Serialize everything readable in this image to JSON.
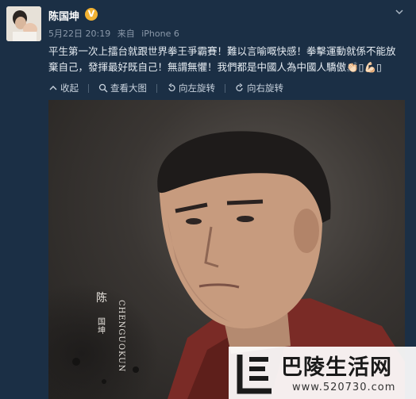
{
  "post": {
    "author": "陈国坤",
    "verified_badge": "V",
    "date": "5月22日 20:19",
    "via_label": "来自",
    "device": "iPhone 6",
    "text_line1": "平生第一次上擂台就跟世界拳王爭霸賽！難以言喻嘅快感！拳擊運動就係不能放",
    "text_line2": "棄自己，發揮最好既自己！無謂無懼！我們都是中國人為中國人驕傲👏🏻▯💪🏻▯"
  },
  "toolbar": {
    "collapse_label": "收起",
    "view_large_label": "查看大图",
    "rotate_left_label": "向左旋转",
    "rotate_right_label": "向右旋转"
  },
  "image": {
    "name_vertical": "陈",
    "name_small": "国坤",
    "name_english": "CHENGUOKUN"
  },
  "watermark": {
    "title": "巴陵生活网",
    "url": "www.520730.com"
  },
  "colors": {
    "background": "#1b2f45",
    "badge": "#f2b233"
  }
}
